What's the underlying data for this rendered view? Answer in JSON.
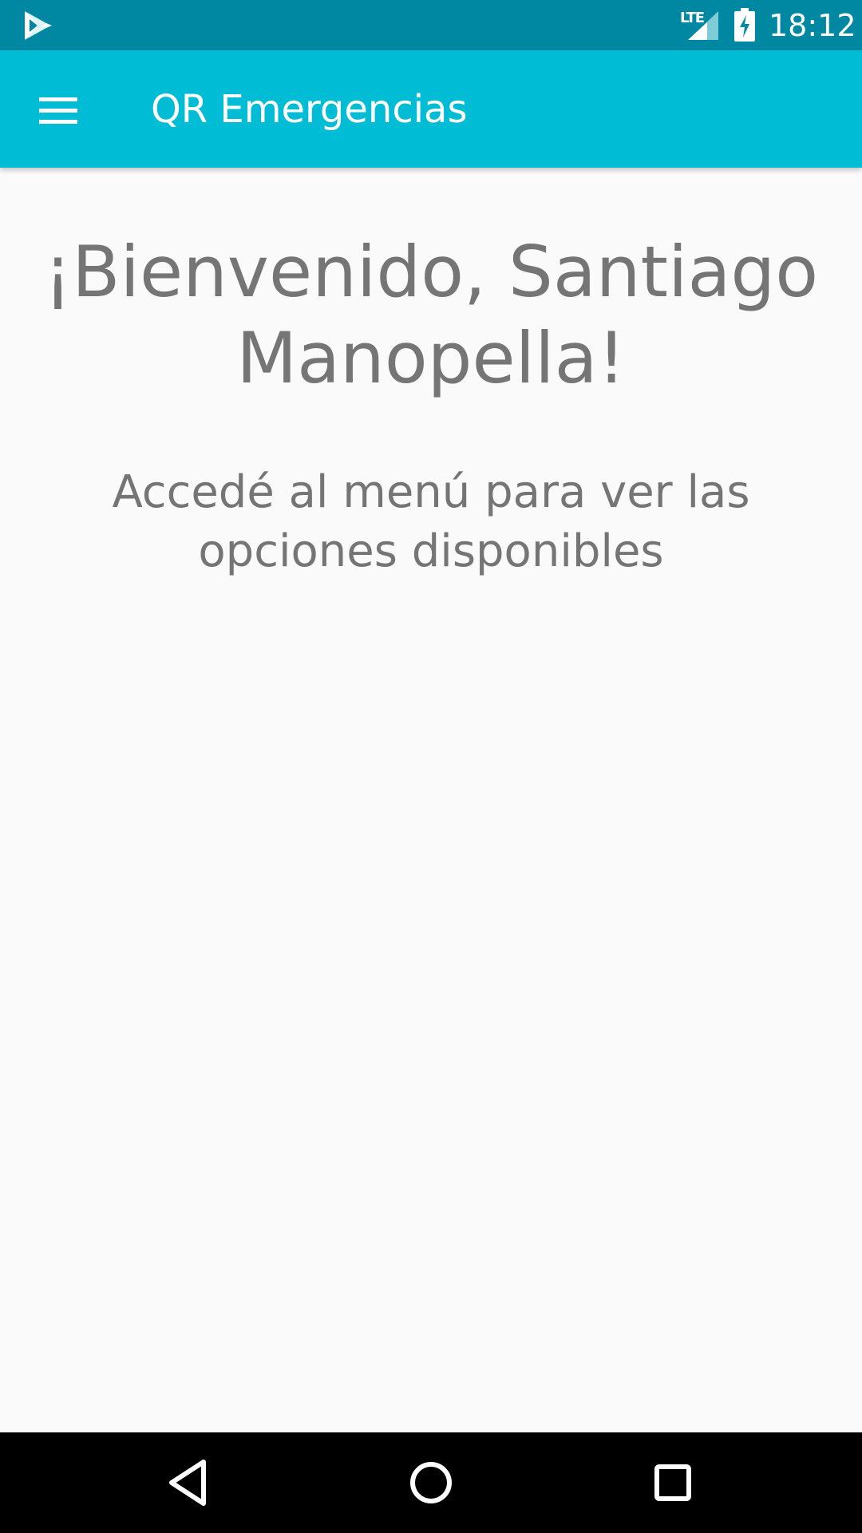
{
  "status_bar": {
    "time": "18:12",
    "network": "LTE",
    "background_color": "#0088A3",
    "icons": [
      "play-store-icon",
      "lte-signal-icon",
      "battery-charging-icon"
    ]
  },
  "app_bar": {
    "title": "QR Emergencias",
    "background_color": "#00BCD4",
    "menu_icon": "hamburger-menu-icon"
  },
  "main": {
    "welcome_title": "¡Bienvenido, Santiago Manopella!",
    "subtitle": "Accedé al menú para ver las opciones disponibles",
    "text_color": "#757575"
  },
  "nav_bar": {
    "icons": [
      "back-icon",
      "home-icon",
      "recents-icon"
    ]
  }
}
